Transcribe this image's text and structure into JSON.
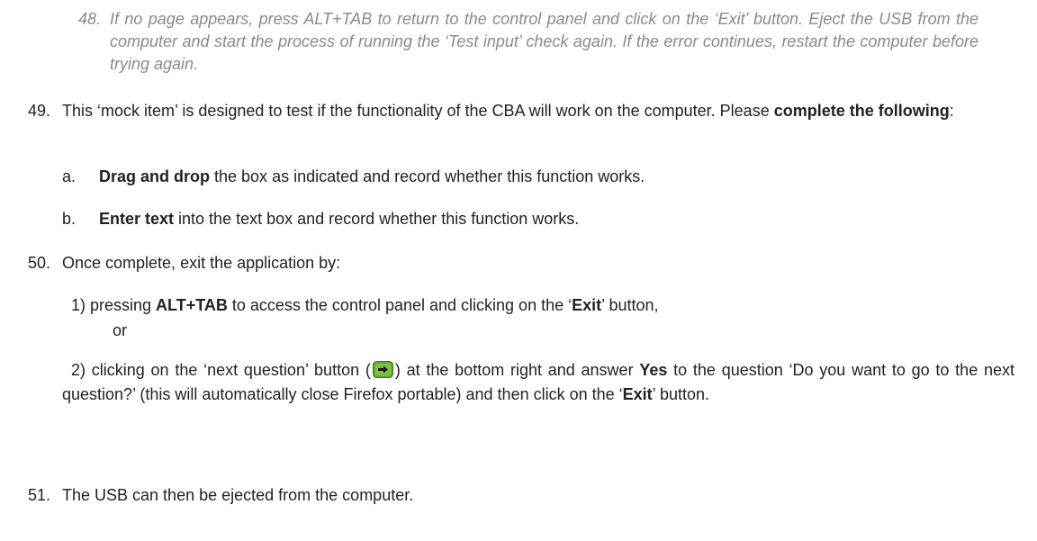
{
  "note48": {
    "number": "48.",
    "text": "If no page appears, press ALT+TAB to return to the control panel and click on the ‘Exit’ button. Eject the USB from the computer and start the process of running the ‘Test input’ check again. If the error continues, restart the computer before trying again."
  },
  "item49": {
    "number": "49.",
    "text_a": "This ‘mock item’ is designed to test if the functionality of the CBA will work on the computer. Please ",
    "bold": "complete the following",
    "text_b": ":",
    "subitems": [
      {
        "letter": "a.",
        "bold": "Drag and drop",
        "text": " the box as indicated and record whether this function works."
      },
      {
        "letter": "b.",
        "bold": "Enter text",
        "text": " into the text box and record whether this function works."
      }
    ]
  },
  "item50": {
    "number": "50.",
    "intro": "Once complete, exit the application by:",
    "option1": {
      "prefix": "1) pressing ",
      "key": "ALT+TAB",
      "middle": " to access the control panel and clicking on the ‘",
      "exit": "Exit",
      "suffix": "’ button,"
    },
    "or": "or",
    "option2": {
      "prefix": "2) clicking on the ‘next question’ button (",
      "after_icon": ") at the bottom right and answer ",
      "yes": "Yes",
      "middle": " to the question ‘Do you want to go to the next question?’ (this will automatically close Firefox portable) and then click on the ‘",
      "exit": "Exit",
      "suffix": "’ button."
    },
    "icon": "next-question-arrow-icon",
    "icon_colors": {
      "outer": "#5aa02c",
      "inner": "#7cc242",
      "arrow": "#1a1a1a"
    }
  },
  "item51": {
    "number": "51.",
    "text": "The USB can then be ejected from the computer."
  }
}
